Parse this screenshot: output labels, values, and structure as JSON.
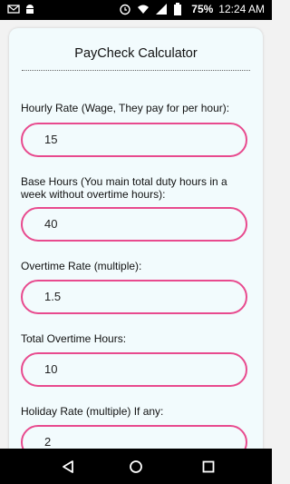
{
  "status_bar": {
    "battery_text": "75%",
    "time": "12:24 AM",
    "icons": [
      "mail-icon",
      "android-icon",
      "alarm-icon",
      "wifi-icon",
      "signal-icon",
      "battery-icon"
    ]
  },
  "app": {
    "title": "PayCheck Calculator"
  },
  "fields": [
    {
      "label": "Hourly Rate (Wage, They pay for per hour):",
      "value": "15"
    },
    {
      "label": "Base Hours (You main total duty hours in a week without overtime hours):",
      "value": "40"
    },
    {
      "label": "Overtime Rate (multiple):",
      "value": "1.5"
    },
    {
      "label": "Total Overtime Hours:",
      "value": "10"
    },
    {
      "label": "Holiday Rate (multiple) If any:",
      "value": "2"
    }
  ],
  "colors": {
    "accent": "#e84a8e",
    "card_background": "#f2fbfd"
  },
  "nav_bar": {
    "icons": [
      "back-icon",
      "home-icon",
      "recents-icon"
    ]
  }
}
